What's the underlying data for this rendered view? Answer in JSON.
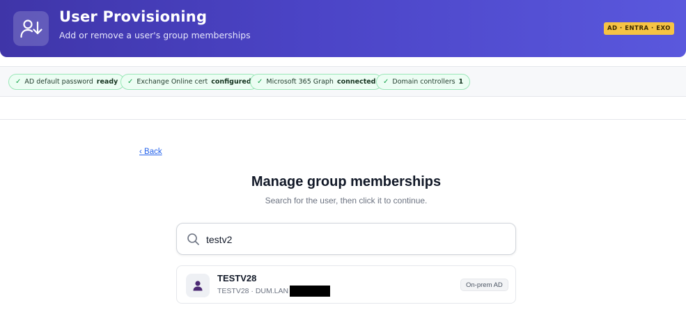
{
  "header": {
    "title": "User Provisioning",
    "subtitle": "Add or remove a user's group memberships",
    "env_badge": "AD · ENTRA · EXO",
    "icon": "user-arrow-down-icon"
  },
  "status_pills": [
    {
      "label": "AD default password",
      "value": "ready"
    },
    {
      "label": "Exchange Online cert",
      "value": "configured"
    },
    {
      "label": "Microsoft 365 Graph",
      "value": "connected"
    },
    {
      "label": "Domain controllers",
      "value": "1"
    }
  ],
  "nav": {
    "back_label": "‹ Back"
  },
  "main": {
    "title": "Manage group memberships",
    "hint": "Search for the user, then click it to continue."
  },
  "search": {
    "value": "testv2",
    "icon": "search-icon"
  },
  "results": [
    {
      "name": "TESTV28",
      "sub": "TESTV28 · DUM.LAN",
      "source": "On-prem AD",
      "icon": "user-icon"
    }
  ],
  "colors": {
    "header_start": "#3f35a8",
    "header_end": "#5a58dd",
    "badge": "#f6c344",
    "pill_bg": "#ecfdf3",
    "pill_border": "#9be7b8",
    "check": "#16a34a",
    "link": "#2563eb",
    "avatar": "#4c2a73"
  }
}
